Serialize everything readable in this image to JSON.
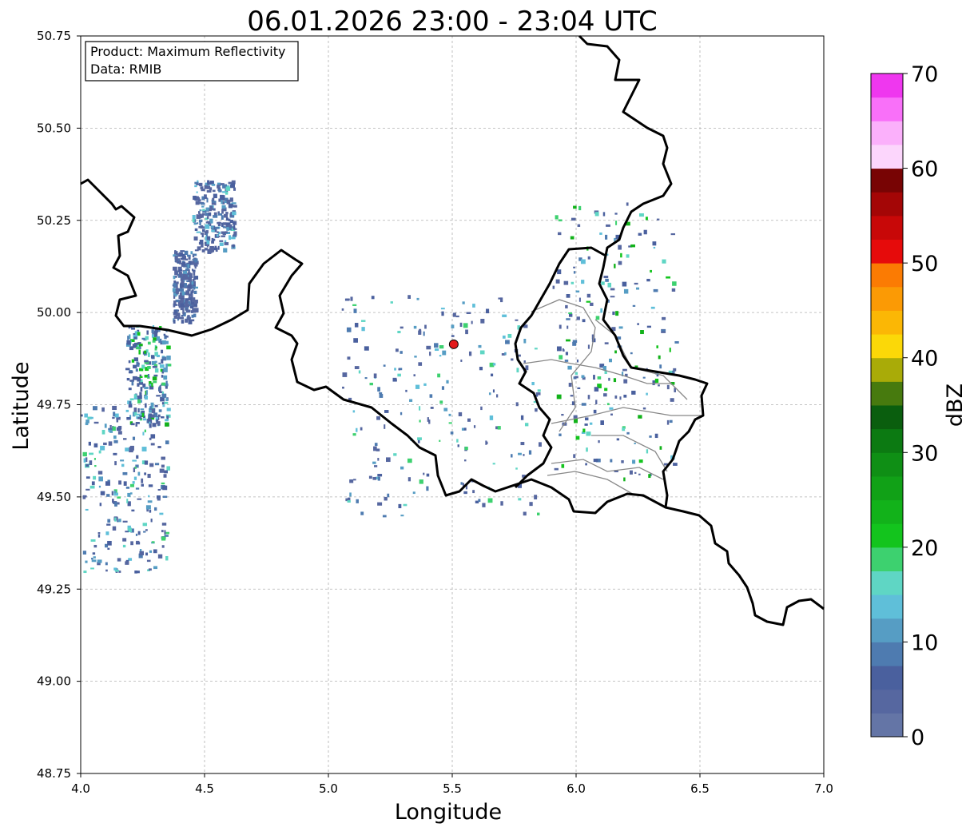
{
  "title": "06.01.2026 23:00 - 23:04 UTC",
  "info_box": {
    "product_line": "Product: Maximum Reflectivity",
    "data_line": "Data: RMIB"
  },
  "axes": {
    "xlabel": "Longitude",
    "ylabel": "Latitude",
    "xlim": [
      4.0,
      7.0
    ],
    "ylim": [
      48.75,
      50.75
    ],
    "x_ticks": [
      "4.0",
      "4.5",
      "5.0",
      "5.5",
      "6.0",
      "6.5",
      "7.0"
    ],
    "y_ticks": [
      "48.75",
      "49.00",
      "49.25",
      "49.50",
      "49.75",
      "50.00",
      "50.25",
      "50.50",
      "50.75"
    ],
    "grid": true
  },
  "colorbar": {
    "label": "dBZ",
    "range": [
      0,
      70
    ],
    "tick_labels": [
      "0",
      "10",
      "20",
      "30",
      "40",
      "50",
      "60",
      "70"
    ],
    "colors": [
      "#6475a6",
      "#5667a0",
      "#4a609e",
      "#4e7bb0",
      "#569dc4",
      "#5fbfd9",
      "#5fd6c4",
      "#3dd16f",
      "#13c41d",
      "#12b21a",
      "#11a117",
      "#0f8f15",
      "#0c7a12",
      "#0a5e0e",
      "#477a0e",
      "#a9ab08",
      "#fbd808",
      "#fbb705",
      "#fb9a05",
      "#fb7b03",
      "#e60b0b",
      "#c80808",
      "#a40606",
      "#780404",
      "#fcd6fc",
      "#fbb0fb",
      "#f970f9",
      "#ef37ef"
    ]
  },
  "radar_site": {
    "lon": 5.506,
    "lat": 49.914,
    "color": "#e31a1c"
  },
  "chart_data": {
    "type": "heatmap",
    "title": "06.01.2026 23:00 - 23:04 UTC",
    "xlabel": "Longitude",
    "ylabel": "Latitude",
    "xlim": [
      4.0,
      7.0
    ],
    "ylim": [
      48.75,
      50.75
    ],
    "colorbar_label": "dBZ",
    "colorbar_range": [
      0,
      70
    ],
    "grid": true,
    "echo_clusters": [
      {
        "lon": [
          4.45,
          4.62
        ],
        "lat": [
          50.17,
          50.36
        ],
        "dbz": [
          3,
          16
        ]
      },
      {
        "lon": [
          4.37,
          4.46
        ],
        "lat": [
          49.98,
          50.17
        ],
        "dbz": [
          3,
          12
        ]
      },
      {
        "lon": [
          4.18,
          4.35
        ],
        "lat": [
          49.7,
          49.97
        ],
        "dbz": [
          5,
          25
        ]
      },
      {
        "lon": [
          4.0,
          4.35
        ],
        "lat": [
          49.3,
          49.75
        ],
        "dbz": [
          3,
          20
        ]
      },
      {
        "lon": [
          5.9,
          6.4
        ],
        "lat": [
          49.55,
          50.3
        ],
        "dbz": [
          3,
          25
        ]
      },
      {
        "lon": [
          5.05,
          5.85
        ],
        "lat": [
          49.45,
          50.05
        ],
        "dbz": [
          3,
          20
        ]
      }
    ]
  }
}
